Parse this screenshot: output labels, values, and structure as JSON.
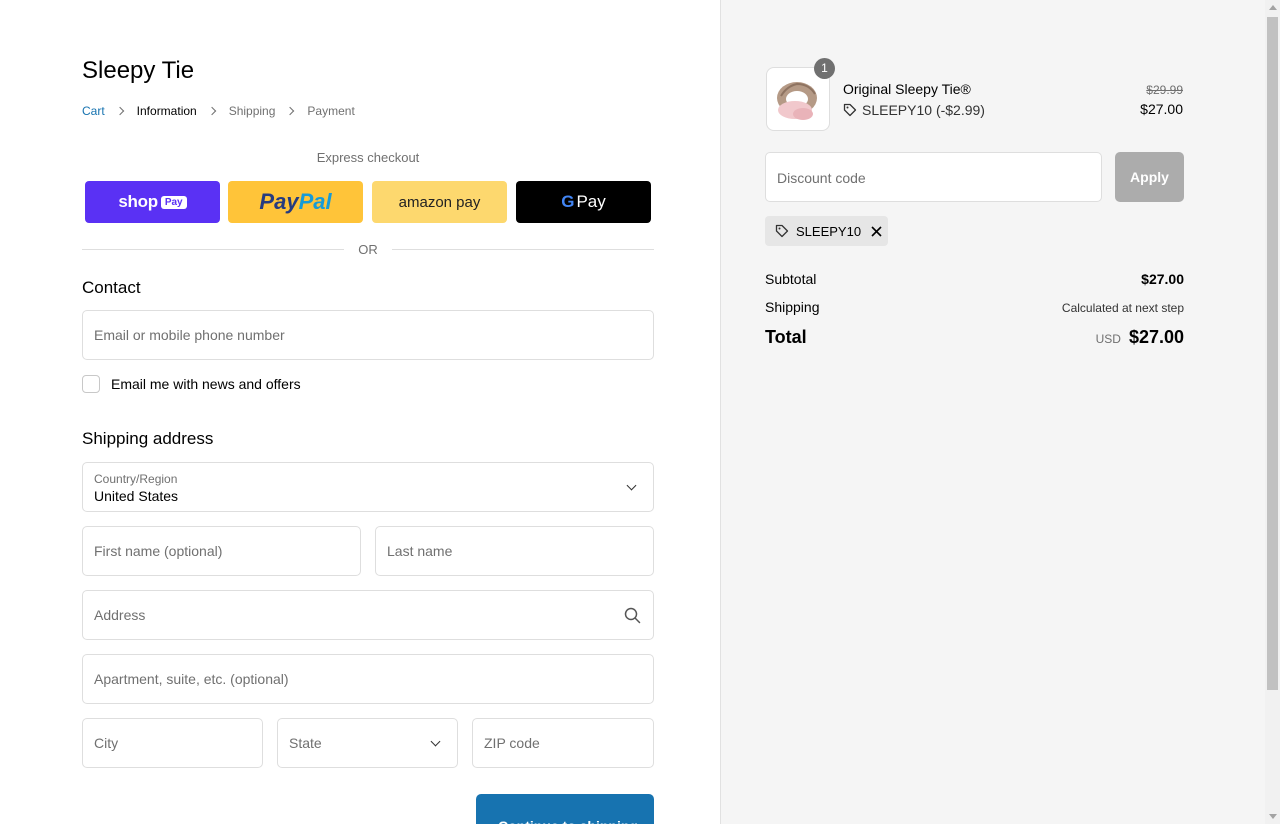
{
  "shop": {
    "name": "Sleepy Tie"
  },
  "breadcrumb": {
    "items": [
      {
        "label": "Cart"
      },
      {
        "label": "Information"
      },
      {
        "label": "Shipping"
      },
      {
        "label": "Payment"
      }
    ]
  },
  "express": {
    "label": "Express checkout",
    "shop_pay": {
      "word": "shop",
      "box": "Pay"
    },
    "paypal": {
      "part1": "Pay",
      "part2": "Pal"
    },
    "amazon": {
      "label": "amazon pay"
    },
    "gpay": {
      "g": "G",
      "label": "Pay"
    },
    "or_label": "OR"
  },
  "contact": {
    "title": "Contact",
    "email_placeholder": "Email or mobile phone number",
    "newsletter_label": "Email me with news and offers"
  },
  "shipping_address": {
    "title": "Shipping address",
    "country_label": "Country/Region",
    "country_value": "United States",
    "first_name_placeholder": "First name (optional)",
    "last_name_placeholder": "Last name",
    "address_placeholder": "Address",
    "apartment_placeholder": "Apartment, suite, etc. (optional)",
    "city_placeholder": "City",
    "state_placeholder": "State",
    "zip_placeholder": "ZIP code"
  },
  "continue_button": {
    "label": "Continue to shipping"
  },
  "order": {
    "quantity": "1",
    "product_name": "Original Sleepy Tie®",
    "discount_line": "SLEEPY10 (-$2.99)",
    "old_price": "$29.99",
    "new_price": "$27.00",
    "discount_placeholder": "Discount code",
    "apply_label": "Apply",
    "applied_code": "SLEEPY10",
    "subtotal_label": "Subtotal",
    "subtotal_value": "$27.00",
    "shipping_label": "Shipping",
    "shipping_value": "Calculated at next step",
    "total_label": "Total",
    "total_currency": "USD",
    "total_value": "$27.00"
  },
  "colors": {
    "link": "#1773b0",
    "shop_pay": "#5a31f4",
    "paypal": "#ffc439",
    "amazon_pay": "#fdd86e",
    "gpay": "#000000",
    "apply_disabled": "#acacac"
  }
}
